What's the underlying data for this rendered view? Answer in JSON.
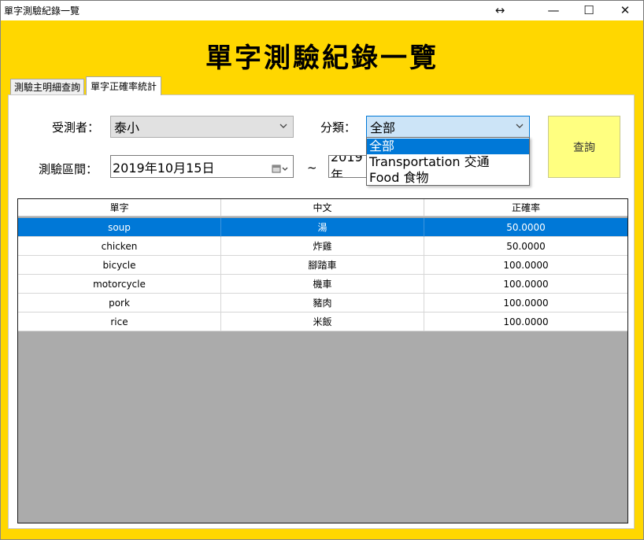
{
  "window": {
    "title": "單字測驗紀錄一覽",
    "buttons": {
      "resize": "↔",
      "minimize": "—",
      "maximize": "☐",
      "close": "✕"
    }
  },
  "app_title": "單字測驗紀錄一覽",
  "tabs": [
    {
      "label": "測驗主明細查詢",
      "active": false
    },
    {
      "label": "單字正確率統計",
      "active": true
    }
  ],
  "filters": {
    "tester_label": "受測者：",
    "tester_value": "泰小",
    "category_label": "分類：",
    "category_value": "全部",
    "category_options": [
      "全部",
      "Transportation 交通",
      "Food 食物"
    ],
    "date_label": "測驗區間：",
    "date_from": "2019年10月15日",
    "date_separator": "~",
    "date_to": "2019年",
    "query_button": "查詢"
  },
  "grid": {
    "columns": [
      "單字",
      "中文",
      "正確率"
    ],
    "rows": [
      {
        "word": "soup",
        "chinese": "湯",
        "rate": "50.0000"
      },
      {
        "word": "chicken",
        "chinese": "炸雞",
        "rate": "50.0000"
      },
      {
        "word": "bicycle",
        "chinese": "腳踏車",
        "rate": "100.0000"
      },
      {
        "word": "motorcycle",
        "chinese": "機車",
        "rate": "100.0000"
      },
      {
        "word": "pork",
        "chinese": "豬肉",
        "rate": "100.0000"
      },
      {
        "word": "rice",
        "chinese": "米飯",
        "rate": "100.0000"
      }
    ]
  },
  "colors": {
    "background": "#ffd700",
    "selection": "#0078d7",
    "query_button": "#ffff80",
    "grid_empty": "#ababab"
  }
}
